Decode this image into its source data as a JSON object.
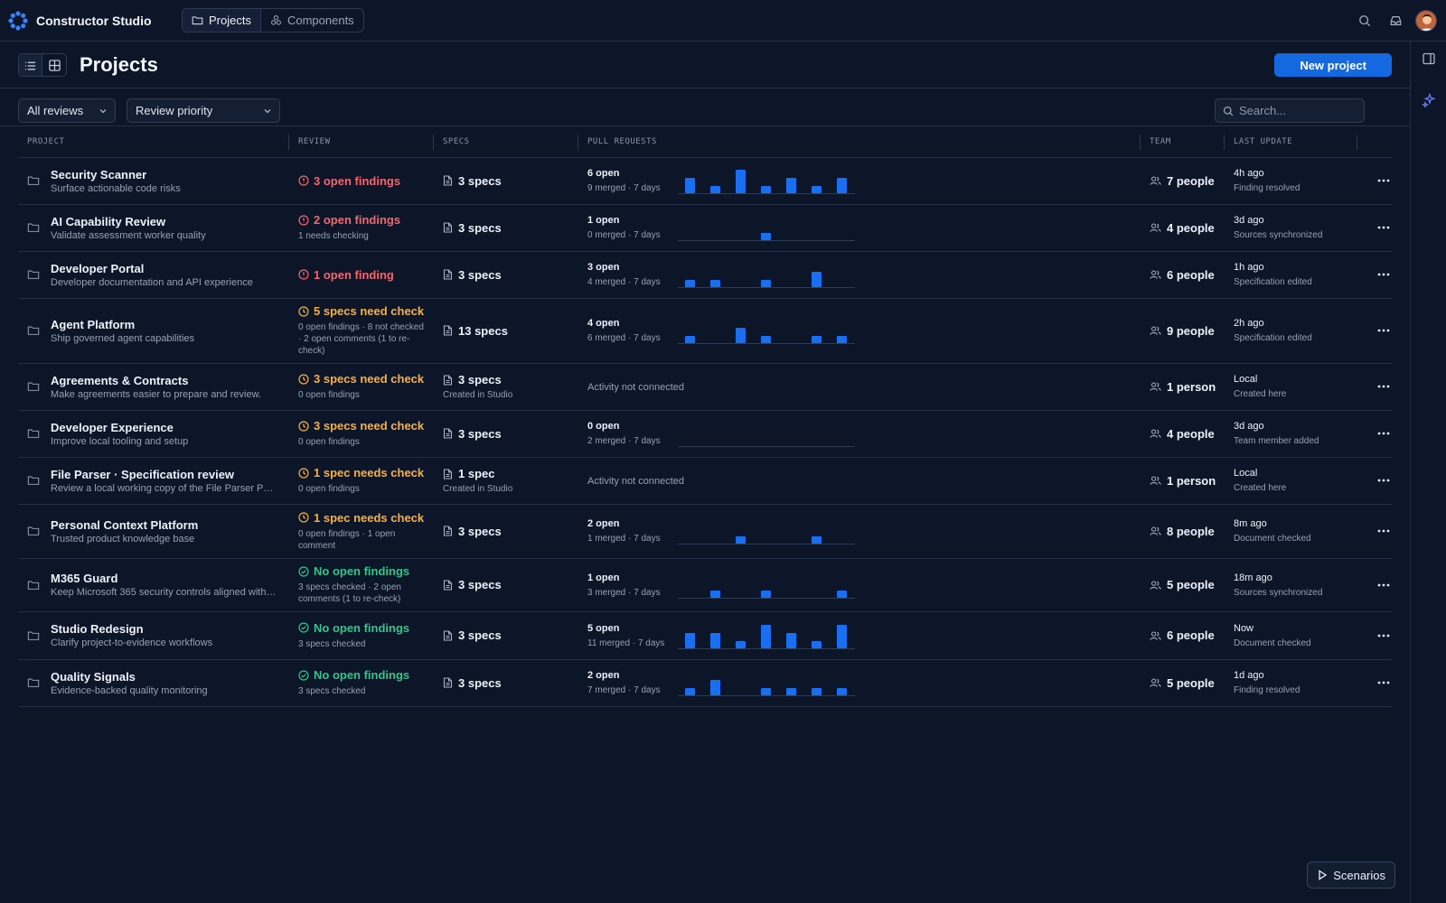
{
  "app": {
    "name": "Constructor Studio",
    "nav_tabs": [
      {
        "label": "Projects",
        "icon": "folder-icon",
        "active": true
      },
      {
        "label": "Components",
        "icon": "components-icon",
        "active": false
      }
    ]
  },
  "page": {
    "title": "Projects",
    "new_button": "New project",
    "filters": {
      "review_filter": "All reviews",
      "sort": "Review priority",
      "search_placeholder": "Search..."
    }
  },
  "table": {
    "columns": [
      "PROJECT",
      "REVIEW",
      "SPECS",
      "PULL REQUESTS",
      "TEAM",
      "LAST UPDATE"
    ],
    "rows": [
      {
        "name": "Security Scanner",
        "desc": "Surface actionable code risks",
        "review_status": "red",
        "review": "3 open findings",
        "review_sub": "",
        "specs": "3 specs",
        "specs_sub": "",
        "pr_open": "6 open",
        "pr_merged": "9 merged · 7 days",
        "pr_bars": [
          2,
          1,
          3,
          1,
          2,
          1,
          2
        ],
        "pr_none": "",
        "team": "7 people",
        "updated": "4h ago",
        "updated_sub": "Finding resolved"
      },
      {
        "name": "AI Capability Review",
        "desc": "Validate assessment worker quality",
        "review_status": "red",
        "review": "2 open findings",
        "review_sub": "1 needs checking",
        "specs": "3 specs",
        "specs_sub": "",
        "pr_open": "1 open",
        "pr_merged": "0 merged · 7 days",
        "pr_bars": [
          0,
          0,
          0,
          1,
          0,
          0,
          0
        ],
        "pr_none": "",
        "team": "4 people",
        "updated": "3d ago",
        "updated_sub": "Sources synchronized"
      },
      {
        "name": "Developer Portal",
        "desc": "Developer documentation and API experience",
        "review_status": "red",
        "review": "1 open finding",
        "review_sub": "",
        "specs": "3 specs",
        "specs_sub": "",
        "pr_open": "3 open",
        "pr_merged": "4 merged · 7 days",
        "pr_bars": [
          1,
          1,
          0,
          1,
          0,
          2,
          0
        ],
        "pr_none": "",
        "team": "6 people",
        "updated": "1h ago",
        "updated_sub": "Specification edited"
      },
      {
        "name": "Agent Platform",
        "desc": "Ship governed agent capabilities",
        "review_status": "amber",
        "review": "5 specs need check",
        "review_sub": "0 open findings · 8 not checked · 2 open comments (1 to re-check)",
        "specs": "13 specs",
        "specs_sub": "",
        "pr_open": "4 open",
        "pr_merged": "6 merged · 7 days",
        "pr_bars": [
          1,
          0,
          2,
          1,
          0,
          1,
          1
        ],
        "pr_none": "",
        "team": "9 people",
        "updated": "2h ago",
        "updated_sub": "Specification edited"
      },
      {
        "name": "Agreements & Contracts",
        "desc": "Make agreements easier to prepare and review.",
        "review_status": "amber",
        "review": "3 specs need check",
        "review_sub": "0 open findings",
        "specs": "3 specs",
        "specs_sub": "Created in Studio",
        "pr_open": "",
        "pr_merged": "",
        "pr_bars": [],
        "pr_none": "Activity not connected",
        "team": "1 person",
        "updated": "Local",
        "updated_sub": "Created here"
      },
      {
        "name": "Developer Experience",
        "desc": "Improve local tooling and setup",
        "review_status": "amber",
        "review": "3 specs need check",
        "review_sub": "0 open findings",
        "specs": "3 specs",
        "specs_sub": "",
        "pr_open": "0 open",
        "pr_merged": "2 merged · 7 days",
        "pr_bars": [
          0,
          0,
          0,
          0,
          0,
          0,
          0
        ],
        "pr_none": "",
        "team": "4 people",
        "updated": "3d ago",
        "updated_sub": "Team member added"
      },
      {
        "name": "File Parser · Specification review",
        "desc": "Review a local working copy of the File Parser PRD.",
        "review_status": "amber",
        "review": "1 spec needs check",
        "review_sub": "0 open findings",
        "specs": "1 spec",
        "specs_sub": "Created in Studio",
        "pr_open": "",
        "pr_merged": "",
        "pr_bars": [],
        "pr_none": "Activity not connected",
        "team": "1 person",
        "updated": "Local",
        "updated_sub": "Created here"
      },
      {
        "name": "Personal Context Platform",
        "desc": "Trusted product knowledge base",
        "review_status": "amber",
        "review": "1 spec needs check",
        "review_sub": "0 open findings · 1 open comment",
        "specs": "3 specs",
        "specs_sub": "",
        "pr_open": "2 open",
        "pr_merged": "1 merged · 7 days",
        "pr_bars": [
          0,
          0,
          1,
          0,
          0,
          1,
          0
        ],
        "pr_none": "",
        "team": "8 people",
        "updated": "8m ago",
        "updated_sub": "Document checked"
      },
      {
        "name": "M365 Guard",
        "desc": "Keep Microsoft 365 security controls aligned with a...",
        "review_status": "green",
        "review": "No open findings",
        "review_sub": "3 specs checked · 2 open comments (1 to re-check)",
        "specs": "3 specs",
        "specs_sub": "",
        "pr_open": "1 open",
        "pr_merged": "3 merged · 7 days",
        "pr_bars": [
          0,
          1,
          0,
          1,
          0,
          0,
          1
        ],
        "pr_none": "",
        "team": "5 people",
        "updated": "18m ago",
        "updated_sub": "Sources synchronized"
      },
      {
        "name": "Studio Redesign",
        "desc": "Clarify project-to-evidence workflows",
        "review_status": "green",
        "review": "No open findings",
        "review_sub": "3 specs checked",
        "specs": "3 specs",
        "specs_sub": "",
        "pr_open": "5 open",
        "pr_merged": "11 merged · 7 days",
        "pr_bars": [
          2,
          2,
          1,
          3,
          2,
          1,
          3
        ],
        "pr_none": "",
        "team": "6 people",
        "updated": "Now",
        "updated_sub": "Document checked"
      },
      {
        "name": "Quality Signals",
        "desc": "Evidence-backed quality monitoring",
        "review_status": "green",
        "review": "No open findings",
        "review_sub": "3 specs checked",
        "specs": "3 specs",
        "specs_sub": "",
        "pr_open": "2 open",
        "pr_merged": "7 merged · 7 days",
        "pr_bars": [
          1,
          2,
          0,
          1,
          1,
          1,
          1
        ],
        "pr_none": "",
        "team": "5 people",
        "updated": "1d ago",
        "updated_sub": "Finding resolved"
      }
    ]
  },
  "scenarios_button": "Scenarios",
  "colors": {
    "accent": "#1468e0",
    "red": "#f2676f",
    "amber": "#f3b14a",
    "green": "#33c48b",
    "bar": "#1a6ef0"
  }
}
